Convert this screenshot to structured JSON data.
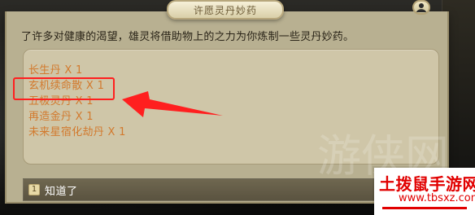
{
  "dialog": {
    "title": "许愿灵丹妙药",
    "intro": "了许多对健康的渴望，雄灵将借助物上的之力为你炼制一些灵丹妙药。",
    "rewards": [
      "长生丹 X 1",
      "玄机续命散 X 1",
      "五极灵丹 X 1",
      "再造金丹 X 1",
      "未来星宿化劫丹 X 1"
    ]
  },
  "option": {
    "number": "1",
    "label": "知道了"
  },
  "watermark": {
    "text": "游侠网"
  },
  "site": {
    "name": "土拨鼠手游网",
    "url": "www.tbsxz.com"
  },
  "colors": {
    "reward_text": "#d27a2e",
    "highlight_red": "#ff1f1f",
    "site_red": "#e10000"
  },
  "icons": [
    "avatar-icon",
    "arrow-indicator-icon"
  ]
}
